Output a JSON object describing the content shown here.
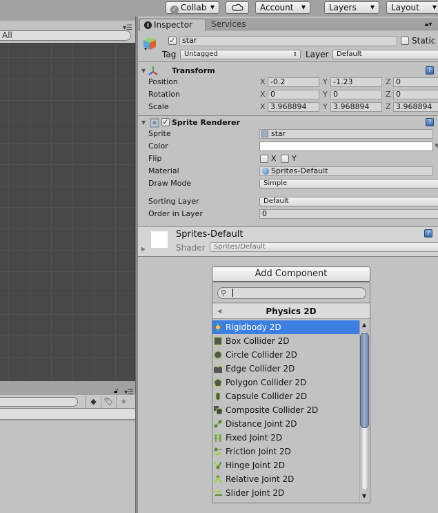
{
  "toolbar": {
    "collab_label": "Collab",
    "cloud_icon": "cloud-icon",
    "account_label": "Account",
    "layers_label": "Layers",
    "layout_label": "Layout"
  },
  "scene": {
    "search_value": "All"
  },
  "inspector": {
    "tabs": [
      {
        "label": "Inspector",
        "active": true
      },
      {
        "label": "Services",
        "active": false
      }
    ],
    "gameobject": {
      "active": true,
      "name": "star",
      "static_label": "Static",
      "static": false,
      "tag_label": "Tag",
      "tag_value": "Untagged",
      "layer_label": "Layer",
      "layer_value": "Default"
    },
    "transform": {
      "title": "Transform",
      "rows": [
        {
          "label": "Position",
          "x": "-0.2",
          "y": "-1.23",
          "z": "0"
        },
        {
          "label": "Rotation",
          "x": "0",
          "y": "0",
          "z": "0"
        },
        {
          "label": "Scale",
          "x": "3.968894",
          "y": "3.968894",
          "z": "3.968894"
        }
      ],
      "axis_labels": [
        "X",
        "Y",
        "Z"
      ]
    },
    "sprite_renderer": {
      "title": "Sprite Renderer",
      "enabled": true,
      "sprite_label": "Sprite",
      "sprite_value": "star",
      "color_label": "Color",
      "color_value": "#ffffff",
      "flip_label": "Flip",
      "flip_x_label": "X",
      "flip_y_label": "Y",
      "material_label": "Material",
      "material_value": "Sprites-Default",
      "draw_mode_label": "Draw Mode",
      "draw_mode_value": "Simple",
      "sorting_layer_label": "Sorting Layer",
      "sorting_layer_value": "Default",
      "order_label": "Order in Layer",
      "order_value": "0"
    },
    "material": {
      "name": "Sprites-Default",
      "shader_label": "Shader",
      "shader_value": "Sprites/Default"
    }
  },
  "add_component": {
    "button_label": "Add Component",
    "search_value": "",
    "category": "Physics 2D",
    "items": [
      {
        "label": "Rigidbody 2D",
        "icon": "rigidbody-2d-icon",
        "selected": true
      },
      {
        "label": "Box Collider 2D",
        "icon": "box-collider-2d-icon"
      },
      {
        "label": "Circle Collider 2D",
        "icon": "circle-collider-2d-icon"
      },
      {
        "label": "Edge Collider 2D",
        "icon": "edge-collider-2d-icon"
      },
      {
        "label": "Polygon Collider 2D",
        "icon": "polygon-collider-2d-icon"
      },
      {
        "label": "Capsule Collider 2D",
        "icon": "capsule-collider-2d-icon"
      },
      {
        "label": "Composite Collider 2D",
        "icon": "composite-collider-2d-icon"
      },
      {
        "label": "Distance Joint 2D",
        "icon": "distance-joint-2d-icon"
      },
      {
        "label": "Fixed Joint 2D",
        "icon": "fixed-joint-2d-icon"
      },
      {
        "label": "Friction Joint 2D",
        "icon": "friction-joint-2d-icon"
      },
      {
        "label": "Hinge Joint 2D",
        "icon": "hinge-joint-2d-icon"
      },
      {
        "label": "Relative Joint 2D",
        "icon": "relative-joint-2d-icon"
      },
      {
        "label": "Slider Joint 2D",
        "icon": "slider-joint-2d-icon"
      }
    ],
    "scroll_fraction_visible": 0.6
  }
}
